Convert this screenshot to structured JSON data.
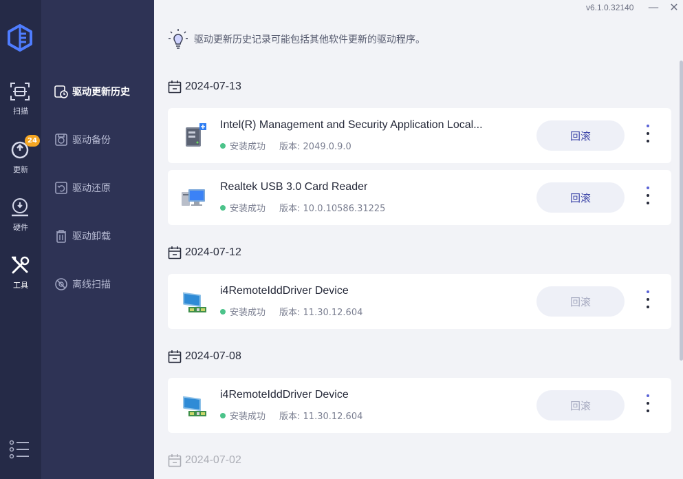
{
  "app": {
    "version": "v6.1.0.32140"
  },
  "rail": {
    "items": [
      {
        "label": "扫描",
        "icon": "scan-icon"
      },
      {
        "label": "更新",
        "icon": "update-icon",
        "badge": "24"
      },
      {
        "label": "硬件",
        "icon": "hardware-icon"
      },
      {
        "label": "工具",
        "icon": "tools-icon",
        "active": true
      }
    ]
  },
  "sub_menu": {
    "items": [
      {
        "label": "驱动更新历史",
        "icon": "history-icon",
        "active": true
      },
      {
        "label": "驱动备份",
        "icon": "backup-icon"
      },
      {
        "label": "驱动还原",
        "icon": "restore-icon"
      },
      {
        "label": "驱动卸载",
        "icon": "uninstall-icon"
      },
      {
        "label": "离线扫描",
        "icon": "offline-scan-icon"
      }
    ]
  },
  "main": {
    "tip": "驱动更新历史记录可能包括其他软件更新的驱动程序。",
    "groups": [
      {
        "date": "2024-07-13"
      },
      {
        "date": "2024-07-12"
      },
      {
        "date": "2024-07-08"
      },
      {
        "date": "2024-07-02"
      }
    ],
    "entries": [
      {
        "name": "Intel(R) Management and Security Application Local...",
        "status": "安装成功",
        "version": "版本: 2049.0.9.0",
        "button": "回滚",
        "icon": "server-driver-icon"
      },
      {
        "name": "Realtek USB 3.0 Card Reader",
        "status": "安装成功",
        "version": "版本: 10.0.10586.31225",
        "button": "回滚",
        "icon": "computer-icon"
      },
      {
        "name": "i4RemoteIddDriver Device",
        "status": "安装成功",
        "version": "版本: 11.30.12.604",
        "button": "回滚",
        "icon": "display-adapter-icon"
      },
      {
        "name": "i4RemoteIddDriver Device",
        "status": "安装成功",
        "version": "版本: 11.30.12.604",
        "button": "回滚",
        "icon": "display-adapter-icon"
      }
    ]
  },
  "colors": {
    "rail": "#252a47",
    "submenu": "#2e3355",
    "accent": "#3d46a8",
    "success": "#4cc38a",
    "badge": "#f5a623"
  }
}
